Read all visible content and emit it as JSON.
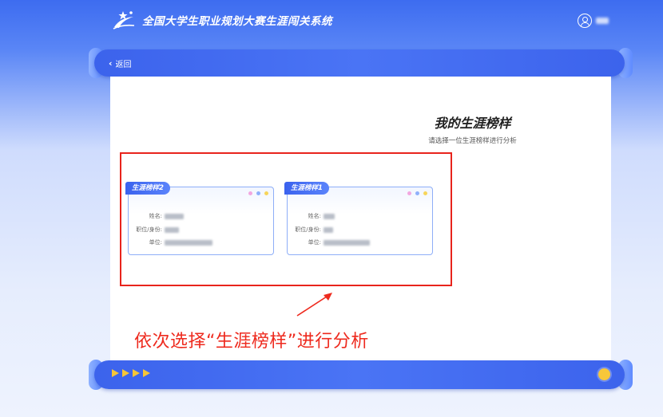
{
  "header": {
    "app_title": "全国大学生职业规划大赛生涯闯关系统",
    "logo_icon": "star-swoosh-logo-icon",
    "avatar_icon": "user-avatar-icon"
  },
  "nav": {
    "back_label": "返回",
    "back_icon": "chevron-left-icon"
  },
  "page": {
    "title": "我的生涯榜样",
    "subtitle": "请选择一位生涯榜样进行分析"
  },
  "cards": [
    {
      "tag": "生涯榜样2",
      "fields": [
        {
          "label": "姓名:"
        },
        {
          "label": "职位/身份:"
        },
        {
          "label": "单位:"
        }
      ]
    },
    {
      "tag": "生涯榜样1",
      "fields": [
        {
          "label": "姓名:"
        },
        {
          "label": "职位/身份:"
        },
        {
          "label": "单位:"
        }
      ]
    }
  ],
  "annotation": {
    "text": "依次选择“生涯榜样”进行分析"
  },
  "colors": {
    "primary": "#3c63ec",
    "accent_yellow": "#f7c73a",
    "annotation_red": "#ee2a1e",
    "card_dot_pink": "#f3a7e0",
    "card_dot_blue": "#8fb0fb",
    "card_dot_yellow": "#f7d55a"
  }
}
